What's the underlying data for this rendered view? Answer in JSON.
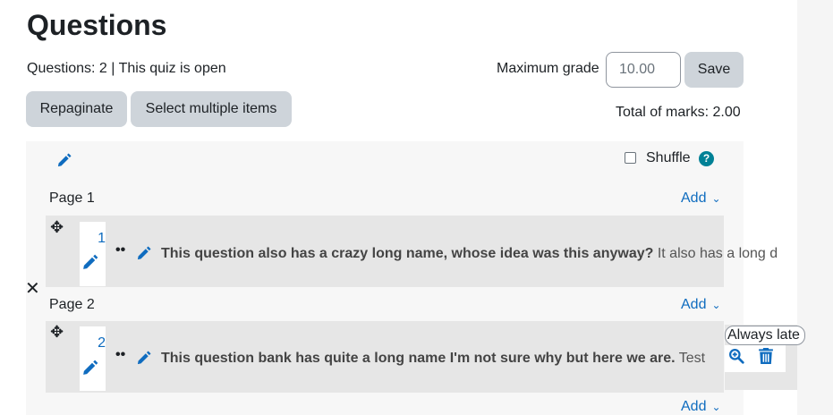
{
  "page": {
    "title": "Questions",
    "status": "Questions: 2 | This quiz is open",
    "max_grade_label": "Maximum grade",
    "max_grade_value": "10.00",
    "save_label": "Save",
    "repaginate_label": "Repaginate",
    "select_multiple_label": "Select multiple items",
    "total_marks": "Total of marks: 2.00"
  },
  "section": {
    "shuffle_label": "Shuffle",
    "help_glyph": "?",
    "pages": [
      {
        "label": "Page 1",
        "add_label": "Add",
        "question": {
          "number": "1",
          "name": "This question also has a crazy long name, whose idea was this anyway?",
          "text": "It also has a long d"
        }
      },
      {
        "label": "Page 2",
        "add_label": "Add",
        "question": {
          "number": "2",
          "name": "This question bank has quite a long name I'm not sure why but here we are.",
          "text": "Test"
        }
      }
    ],
    "bottom_add_label": "Add"
  },
  "dependency_select": "Always late",
  "icons": {
    "edit": "pencil-icon",
    "move": "move-icon",
    "type": "question-type-icon",
    "close": "close-icon",
    "preview": "zoom-in-icon",
    "delete": "trash-icon",
    "chevron": "chevron-down-icon"
  },
  "colors": {
    "link": "#0f6cbf",
    "button_bg": "#ced4da",
    "row_bg": "#e6e6e6",
    "help": "#008196"
  }
}
